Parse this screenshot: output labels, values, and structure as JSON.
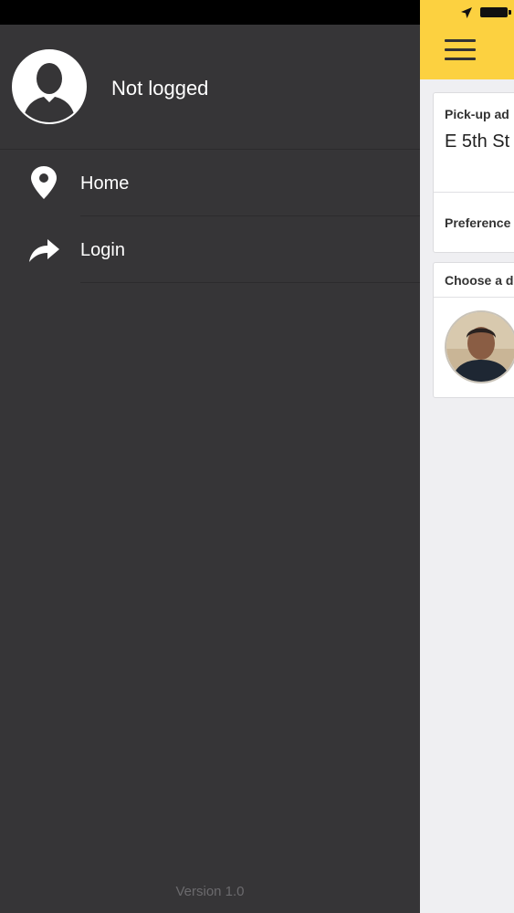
{
  "drawer": {
    "profile": {
      "name": "Not logged"
    },
    "menu": [
      {
        "label": "Home",
        "icon": "map-pin-icon"
      },
      {
        "label": "Login",
        "icon": "share-arrow-icon"
      }
    ],
    "version": "Version 1.0"
  },
  "main": {
    "pickup_label": "Pick-up ad",
    "pickup_address": "E 5th St",
    "preferences_label": "Preference",
    "choose_label": "Choose a d"
  },
  "colors": {
    "drawer_bg": "#363537",
    "accent_yellow": "#fcd140",
    "content_bg": "#efeff2"
  }
}
